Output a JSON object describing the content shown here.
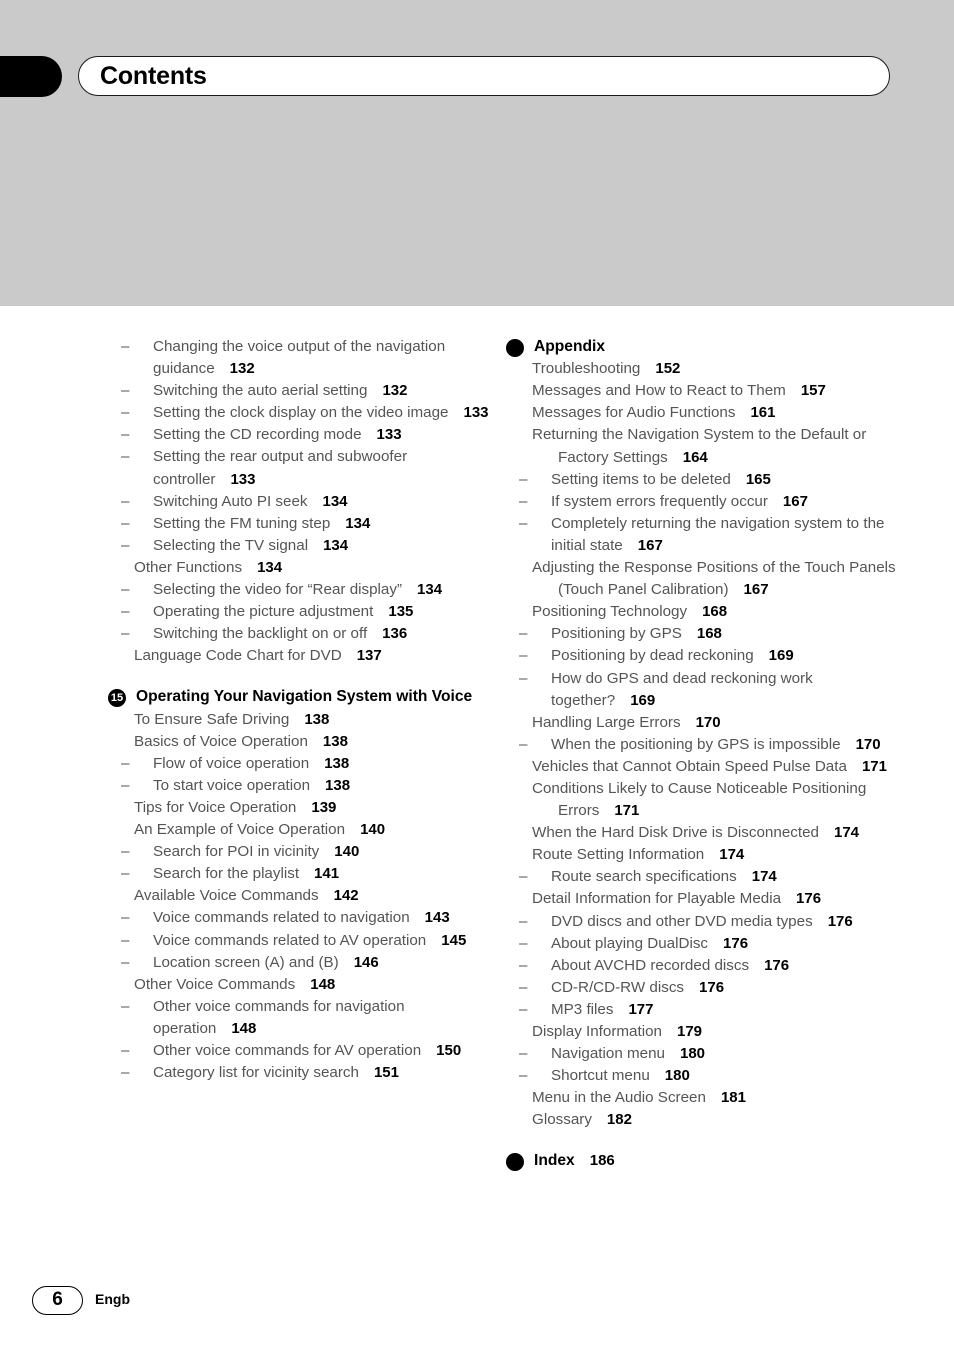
{
  "header": {
    "title": "Contents"
  },
  "footer": {
    "page_number": "6",
    "language_code": "Engb"
  },
  "columns": {
    "left": [
      {
        "type": "item",
        "level": 2,
        "label": "Changing the voice output of the navigation guidance",
        "page": "132"
      },
      {
        "type": "item",
        "level": 2,
        "label": "Switching the auto aerial setting",
        "page": "132"
      },
      {
        "type": "item",
        "level": 2,
        "label": "Setting the clock display on the video image",
        "page": "133"
      },
      {
        "type": "item",
        "level": 2,
        "label": "Setting the CD recording mode",
        "page": "133"
      },
      {
        "type": "item",
        "level": 2,
        "label": "Setting the rear output and subwoofer controller",
        "page": "133"
      },
      {
        "type": "item",
        "level": 2,
        "label": "Switching Auto PI seek",
        "page": "134"
      },
      {
        "type": "item",
        "level": 2,
        "label": "Setting the FM tuning step",
        "page": "134"
      },
      {
        "type": "item",
        "level": 2,
        "label": "Selecting the TV signal",
        "page": "134"
      },
      {
        "type": "item",
        "level": 1,
        "label": "Other Functions",
        "page": "134"
      },
      {
        "type": "item",
        "level": 2,
        "label": "Selecting the video for “Rear display”",
        "page": "134"
      },
      {
        "type": "item",
        "level": 2,
        "label": "Operating the picture adjustment",
        "page": "135"
      },
      {
        "type": "item",
        "level": 2,
        "label": "Switching the backlight on or off",
        "page": "136"
      },
      {
        "type": "item",
        "level": 1,
        "label": "Language Code Chart for DVD",
        "page": "137"
      },
      {
        "type": "chapter",
        "badge": "15",
        "label": "Operating Your Navigation System with Voice",
        "page": ""
      },
      {
        "type": "item",
        "level": 1,
        "label": "To Ensure Safe Driving",
        "page": "138"
      },
      {
        "type": "item",
        "level": 1,
        "label": "Basics of Voice Operation",
        "page": "138"
      },
      {
        "type": "item",
        "level": 2,
        "label": "Flow of voice operation",
        "page": "138"
      },
      {
        "type": "item",
        "level": 2,
        "label": "To start voice operation",
        "page": "138"
      },
      {
        "type": "item",
        "level": 1,
        "label": "Tips for Voice Operation",
        "page": "139"
      },
      {
        "type": "item",
        "level": 1,
        "label": "An Example of Voice Operation",
        "page": "140"
      },
      {
        "type": "item",
        "level": 2,
        "label": "Search for POI in vicinity",
        "page": "140"
      },
      {
        "type": "item",
        "level": 2,
        "label": "Search for the playlist",
        "page": "141"
      },
      {
        "type": "item",
        "level": 1,
        "label": "Available Voice Commands",
        "page": "142"
      },
      {
        "type": "item",
        "level": 2,
        "label": "Voice commands related to navigation",
        "page": "143"
      },
      {
        "type": "item",
        "level": 2,
        "label": "Voice commands related to AV operation",
        "page": "145"
      },
      {
        "type": "item",
        "level": 2,
        "label": "Location screen (A) and (B)",
        "page": "146"
      },
      {
        "type": "item",
        "level": 1,
        "label": "Other Voice Commands",
        "page": "148"
      },
      {
        "type": "item",
        "level": 2,
        "label": "Other voice commands for navigation operation",
        "page": "148"
      },
      {
        "type": "item",
        "level": 2,
        "label": "Other voice commands for AV operation",
        "page": "150"
      },
      {
        "type": "item",
        "level": 2,
        "label": "Category list for vicinity search",
        "page": "151"
      }
    ],
    "right": [
      {
        "type": "chapter",
        "badge": "",
        "label": "Appendix",
        "page": "",
        "tight": true
      },
      {
        "type": "item",
        "level": 1,
        "label": "Troubleshooting",
        "page": "152"
      },
      {
        "type": "item",
        "level": 1,
        "label": "Messages and How to React to Them",
        "page": "157"
      },
      {
        "type": "item",
        "level": 1,
        "label": "Messages for Audio Functions",
        "page": "161"
      },
      {
        "type": "item",
        "level": 1,
        "label": "Returning the Navigation System to the Default or Factory Settings",
        "page": "164"
      },
      {
        "type": "item",
        "level": 2,
        "label": "Setting items to be deleted",
        "page": "165"
      },
      {
        "type": "item",
        "level": 2,
        "label": "If system errors frequently occur",
        "page": "167"
      },
      {
        "type": "item",
        "level": 2,
        "label": "Completely returning the navigation system to the initial state",
        "page": "167"
      },
      {
        "type": "item",
        "level": 1,
        "label": "Adjusting the Response Positions of the Touch Panels (Touch Panel Calibration)",
        "page": "167"
      },
      {
        "type": "item",
        "level": 1,
        "label": "Positioning Technology",
        "page": "168"
      },
      {
        "type": "item",
        "level": 2,
        "label": "Positioning by GPS",
        "page": "168"
      },
      {
        "type": "item",
        "level": 2,
        "label": "Positioning by dead reckoning",
        "page": "169"
      },
      {
        "type": "item",
        "level": 2,
        "label": "How do GPS and dead reckoning work together?",
        "page": "169"
      },
      {
        "type": "item",
        "level": 1,
        "label": "Handling Large Errors",
        "page": "170"
      },
      {
        "type": "item",
        "level": 2,
        "label": "When the positioning by GPS is impossible",
        "page": "170"
      },
      {
        "type": "item",
        "level": 1,
        "label": "Vehicles that Cannot Obtain Speed Pulse Data",
        "page": "171"
      },
      {
        "type": "item",
        "level": 1,
        "label": "Conditions Likely to Cause Noticeable Positioning Errors",
        "page": "171"
      },
      {
        "type": "item",
        "level": 1,
        "label": "When the Hard Disk Drive is Disconnected",
        "page": "174"
      },
      {
        "type": "item",
        "level": 1,
        "label": "Route Setting Information",
        "page": "174"
      },
      {
        "type": "item",
        "level": 2,
        "label": "Route search specifications",
        "page": "174"
      },
      {
        "type": "item",
        "level": 1,
        "label": "Detail Information for Playable Media",
        "page": "176"
      },
      {
        "type": "item",
        "level": 2,
        "label": "DVD discs and other DVD media types",
        "page": "176"
      },
      {
        "type": "item",
        "level": 2,
        "label": "About playing DualDisc",
        "page": "176"
      },
      {
        "type": "item",
        "level": 2,
        "label": "About AVCHD recorded discs",
        "page": "176"
      },
      {
        "type": "item",
        "level": 2,
        "label": "CD-R/CD-RW discs",
        "page": "176"
      },
      {
        "type": "item",
        "level": 2,
        "label": "MP3 files",
        "page": "177"
      },
      {
        "type": "item",
        "level": 1,
        "label": "Display Information",
        "page": "179"
      },
      {
        "type": "item",
        "level": 2,
        "label": "Navigation menu",
        "page": "180"
      },
      {
        "type": "item",
        "level": 2,
        "label": "Shortcut menu",
        "page": "180"
      },
      {
        "type": "item",
        "level": 1,
        "label": "Menu in the Audio Screen",
        "page": "181"
      },
      {
        "type": "item",
        "level": 1,
        "label": "Glossary",
        "page": "182"
      },
      {
        "type": "chapter",
        "badge": "",
        "label": "Index",
        "page": "186"
      }
    ]
  },
  "colors": {
    "header_band": "#cacaca",
    "body_text": "#555555",
    "page_number_text": "#000000",
    "tab": "#000000"
  }
}
